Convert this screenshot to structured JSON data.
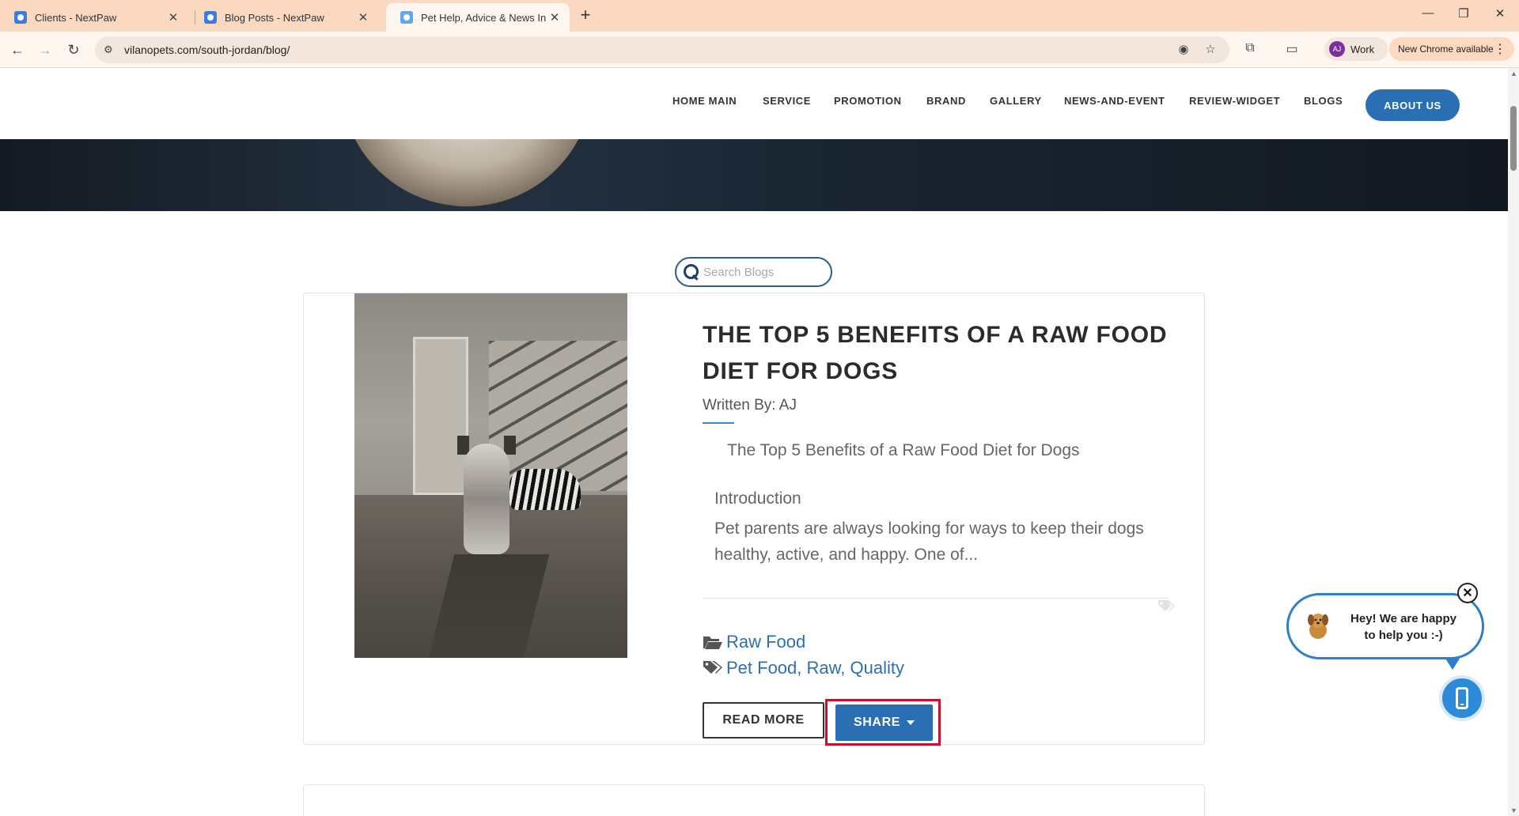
{
  "browser": {
    "tabs": [
      {
        "title": "Clients - NextPaw",
        "icon": "nextpaw-favicon"
      },
      {
        "title": "Blog Posts - NextPaw",
        "icon": "nextpaw-favicon"
      },
      {
        "title": "Pet Help, Advice & News In Sou",
        "icon": "vilano-favicon",
        "active": true
      }
    ],
    "new_tab_label": "+",
    "url": "vilanopets.com/south-jordan/blog/",
    "profile": {
      "initials": "AJ",
      "label": "Work"
    },
    "update_chip": "New Chrome available",
    "window_controls": {
      "minimize": "—",
      "restore": "❐",
      "close": "✕"
    }
  },
  "site_nav": {
    "links": [
      "HOME MAIN",
      "SERVICE",
      "PROMOTION",
      "BRAND",
      "GALLERY",
      "NEWS-AND-EVENT",
      "REVIEW-WIDGET",
      "BLOGS"
    ],
    "cta": "ABOUT US"
  },
  "search": {
    "placeholder": "Search Blogs",
    "value": ""
  },
  "post": {
    "title": "THE TOP 5 BENEFITS OF A RAW FOOD DIET FOR DOGS",
    "byline": "Written By: AJ",
    "subtitle": "The Top 5 Benefits of a Raw Food Diet for Dogs",
    "intro_heading": "Introduction",
    "excerpt": "Pet parents are always looking for ways to keep their dogs healthy, active, and happy. One of...",
    "category": "Raw Food",
    "tags": "Pet Food, Raw, Quality",
    "read_more": "READ MORE",
    "share": "SHARE"
  },
  "chat": {
    "message": "Hey! We are happy to help you :-)",
    "close": "✕"
  },
  "colors": {
    "accent": "#2a6fb4",
    "link": "#2d6fb0",
    "highlight": "#c8102e",
    "tabstrip": "#fbd9c0"
  }
}
